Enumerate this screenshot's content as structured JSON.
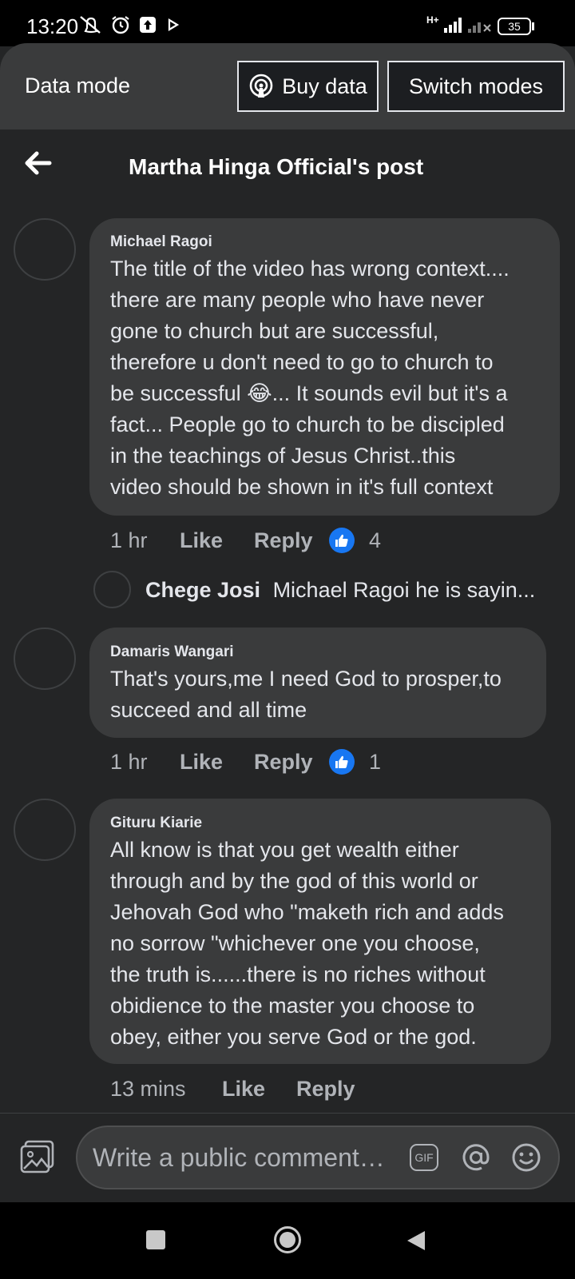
{
  "status_bar": {
    "time": "13:20",
    "network": "H+",
    "battery": "35"
  },
  "banner": {
    "title": "Data mode",
    "buy_data_label": "Buy data",
    "switch_modes_label": "Switch modes"
  },
  "header": {
    "title": "Martha Hinga Official's post"
  },
  "comments": [
    {
      "author": "Michael Ragoi",
      "lines": [
        "The title of the video has wrong context....",
        "there are many people who have never",
        "gone to church but are successful,",
        "therefore u don't need to go to church to",
        "be successful",
        "... It sounds evil but it's a",
        "fact... People go to church to be discipled",
        "in the teachings of Jesus Christ..this",
        "video should be shown in it's full context"
      ],
      "emoji": "😂",
      "time": "1 hr",
      "like_label": "Like",
      "reply_label": "Reply",
      "reaction_count": "4",
      "reply_preview": {
        "author": "Chege Josi",
        "text": "Michael Ragoi he is sayin..."
      }
    },
    {
      "author": "Damaris Wangari",
      "lines": [
        "That's yours,me I need God to prosper,to",
        "succeed and all time"
      ],
      "time": "1 hr",
      "like_label": "Like",
      "reply_label": "Reply",
      "reaction_count": "1"
    },
    {
      "author": "Gituru Kiarie",
      "lines": [
        "All know is that you get wealth either",
        "through and by the god of this world or",
        "Jehovah God who \"maketh rich and adds",
        "no sorrow \"whichever one you choose,",
        "the truth is......there is no riches without",
        "obidience to the master you choose to",
        "obey, either you serve God or the god."
      ],
      "time": "13 mins",
      "like_label": "Like",
      "reply_label": "Reply"
    }
  ],
  "composer": {
    "placeholder": "Write a public comment…",
    "gif_label": "GIF"
  },
  "colors": {
    "background": "#242526",
    "bubble": "#3a3b3c",
    "like_blue": "#1877f2"
  }
}
